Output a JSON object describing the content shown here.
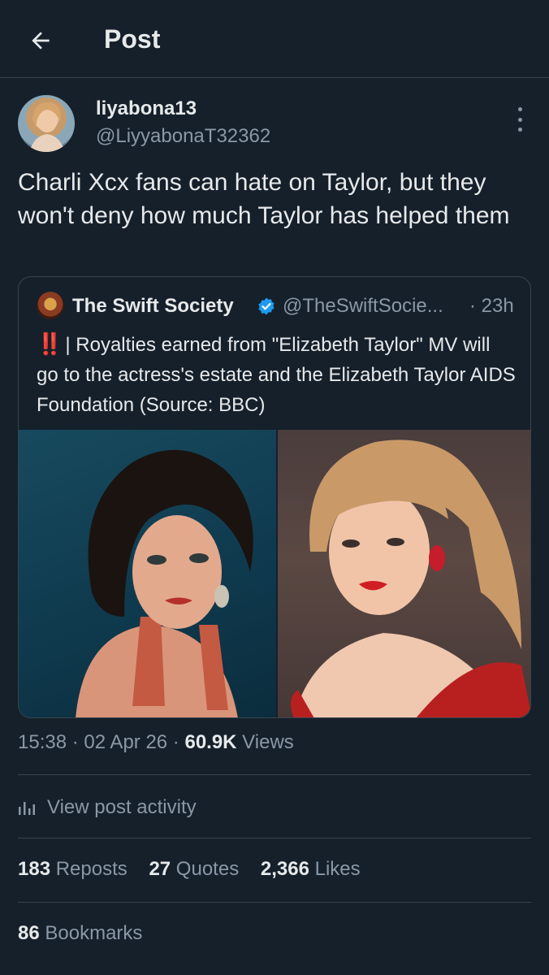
{
  "header": {
    "title": "Post"
  },
  "post": {
    "author_name": "liyabona13",
    "author_handle": "@LiyyabonaT32362",
    "text": "Charli Xcx fans can hate on Taylor, but they won't deny how much Taylor has helped them"
  },
  "quote": {
    "author_name": "The Swift Society",
    "author_handle": "@TheSwiftSocie...",
    "time": "· 23h",
    "alert": "‼️",
    "text": "| Royalties earned from \"Elizabeth Taylor\" MV will go to the actress's estate and the Elizabeth Taylor AIDS Foundation (Source: BBC)"
  },
  "meta": {
    "time": "15:38",
    "sep1": " · ",
    "date": "02 Apr 26",
    "sep2": " · ",
    "views_count": "60.9K",
    "views_label": " Views"
  },
  "activity": {
    "label": "View post activity"
  },
  "stats": {
    "reposts_count": "183",
    "reposts_label": " Reposts",
    "quotes_count": "27",
    "quotes_label": " Quotes",
    "likes_count": "2,366",
    "likes_label": " Likes"
  },
  "bookmarks": {
    "count": "86",
    "label": " Bookmarks"
  },
  "colors": {
    "background": "#15202b",
    "text": "#e7e9ea",
    "secondary_text": "#8b98a5",
    "divider": "#38444d",
    "verified": "#1d9bf0",
    "alert": "#f4212e"
  },
  "icons": [
    "back-arrow-icon",
    "more-icon",
    "verified-icon",
    "bar-chart-icon"
  ]
}
